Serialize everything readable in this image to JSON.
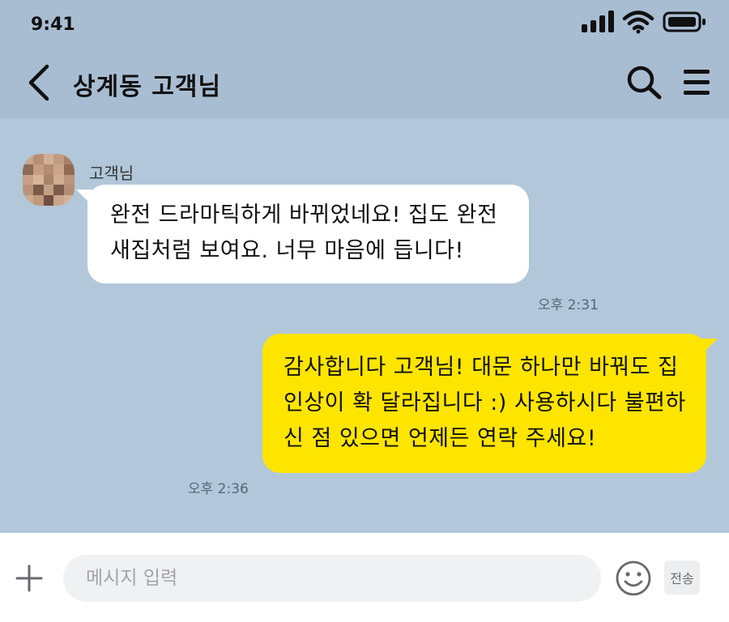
{
  "status_bar": {
    "time": "9:41",
    "icons": [
      "cellular-signal-icon",
      "wifi-icon",
      "battery-icon"
    ]
  },
  "header": {
    "title": "상계동 고객님",
    "icons": [
      "back-arrow-icon",
      "search-icon",
      "hamburger-menu-icon"
    ]
  },
  "messages": [
    {
      "direction": "incoming",
      "sender": "고객님",
      "text": "완전 드라마틱하게 바뀌었네요! 집도 완전 새집처럼 보여요. 너무 마음에 듭니다!",
      "time": "오후 2:31"
    },
    {
      "direction": "outgoing",
      "text": "감사합니다 고객님! 대문 하나만 바꿔도 집 인상이 확 달라집니다 :) 사용하시다 불편하신 점 있으면 언제든 연락 주세요!",
      "time": "오후 2:36"
    }
  ],
  "input_bar": {
    "placeholder": "메시지 입력",
    "value": "",
    "send_label": "전송",
    "icons": [
      "plus-icon",
      "emoji-icon"
    ]
  },
  "colors": {
    "chat_background": "#b2c7d9",
    "header_background": "#a9bdd2",
    "incoming_bubble": "#ffffff",
    "outgoing_bubble": "#fee500",
    "input_bar_background": "#ffffff"
  }
}
